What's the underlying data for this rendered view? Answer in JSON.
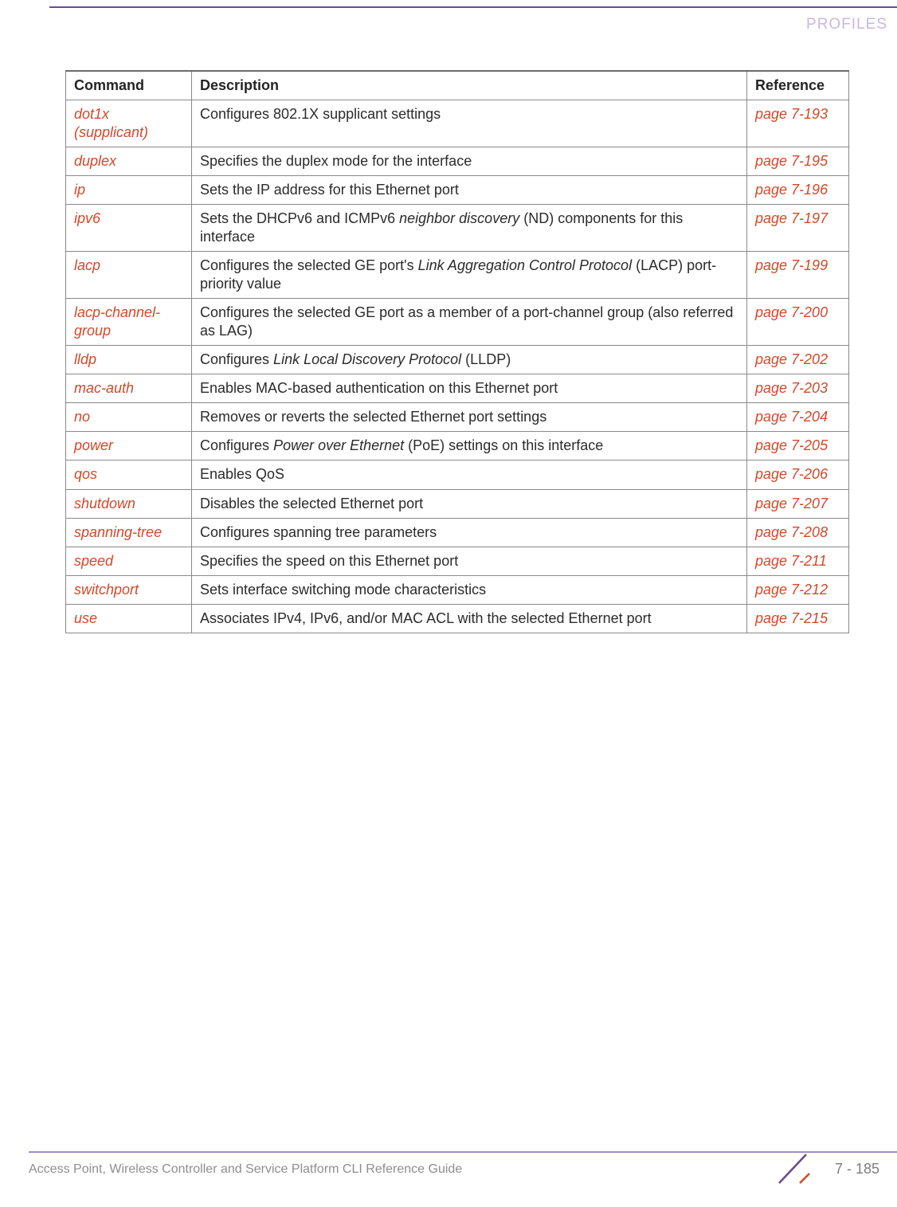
{
  "header": {
    "section_label": "PROFILES"
  },
  "table": {
    "headers": {
      "command": "Command",
      "description": "Description",
      "reference": "Reference"
    },
    "rows": [
      {
        "command": "dot1x (supplicant)",
        "description_parts": [
          {
            "t": "Configures 802.1X supplicant settings"
          }
        ],
        "reference": "page 7-193"
      },
      {
        "command": "duplex",
        "description_parts": [
          {
            "t": "Specifies the duplex mode for the interface"
          }
        ],
        "reference": "page 7-195"
      },
      {
        "command": "ip",
        "description_parts": [
          {
            "t": "Sets the IP address for this Ethernet port"
          }
        ],
        "reference": "page 7-196"
      },
      {
        "command": "ipv6",
        "description_parts": [
          {
            "t": "Sets the DHCPv6 and ICMPv6 "
          },
          {
            "t": "neighbor discovery",
            "i": true
          },
          {
            "t": " (ND) components for this interface"
          }
        ],
        "reference": "page 7-197"
      },
      {
        "command": "lacp",
        "description_parts": [
          {
            "t": "Configures the selected GE port's "
          },
          {
            "t": "Link Aggregation Control Protocol",
            "i": true
          },
          {
            "t": " (LACP) port-priority value"
          }
        ],
        "reference": "page 7-199"
      },
      {
        "command": "lacp-channel-group",
        "description_parts": [
          {
            "t": "Configures the selected GE port as a member of a port-channel group (also referred as LAG)"
          }
        ],
        "reference": "page 7-200"
      },
      {
        "command": "lldp",
        "description_parts": [
          {
            "t": "Configures "
          },
          {
            "t": "Link Local Discovery Protocol",
            "i": true
          },
          {
            "t": " (LLDP)"
          }
        ],
        "reference": "page 7-202"
      },
      {
        "command": "mac-auth",
        "description_parts": [
          {
            "t": "Enables MAC-based authentication on this Ethernet port"
          }
        ],
        "reference": "page 7-203"
      },
      {
        "command": "no",
        "description_parts": [
          {
            "t": "Removes or reverts the selected Ethernet port settings"
          }
        ],
        "reference": "page 7-204"
      },
      {
        "command": "power",
        "description_parts": [
          {
            "t": "Configures "
          },
          {
            "t": "Power over Ethernet",
            "i": true
          },
          {
            "t": " (PoE) settings on this interface"
          }
        ],
        "reference": "page 7-205"
      },
      {
        "command": "qos",
        "description_parts": [
          {
            "t": "Enables QoS"
          }
        ],
        "reference": "page 7-206"
      },
      {
        "command": "shutdown",
        "description_parts": [
          {
            "t": "Disables the selected Ethernet port"
          }
        ],
        "reference": "page 7-207"
      },
      {
        "command": "spanning-tree",
        "description_parts": [
          {
            "t": "Configures spanning tree parameters"
          }
        ],
        "reference": "page 7-208"
      },
      {
        "command": "speed",
        "description_parts": [
          {
            "t": "Specifies the speed on this Ethernet port"
          }
        ],
        "reference": "page 7-211"
      },
      {
        "command": "switchport",
        "description_parts": [
          {
            "t": "Sets interface switching mode characteristics"
          }
        ],
        "reference": "page 7-212"
      },
      {
        "command": "use",
        "description_parts": [
          {
            "t": "Associates IPv4, IPv6, and/or MAC ACL with the selected Ethernet port"
          }
        ],
        "reference": "page 7-215"
      }
    ]
  },
  "footer": {
    "guide_title": "Access Point, Wireless Controller and Service Platform CLI Reference Guide",
    "page_number": "7 - 185"
  }
}
